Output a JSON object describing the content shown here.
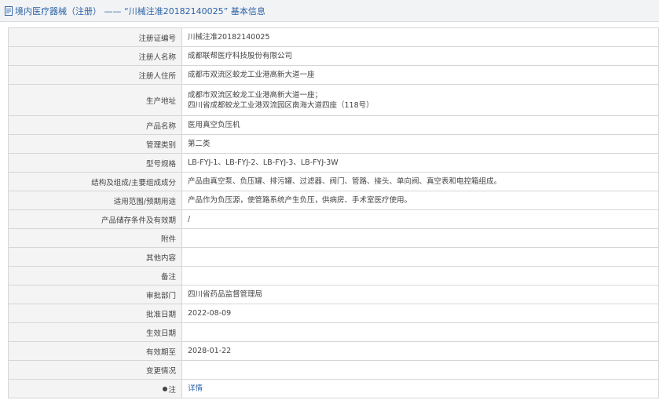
{
  "header": {
    "title": "境内医疗器械（注册） —— “川械注准20182140025” 基本信息"
  },
  "rows": [
    {
      "key": "注册证编号",
      "value": "川械注准20182140025"
    },
    {
      "key": "注册人名称",
      "value": "成都联帮医疗科技股份有限公司"
    },
    {
      "key": "注册人住所",
      "value": "成都市双流区蛟龙工业港高新大道一座"
    },
    {
      "key": "生产地址",
      "value": "成都市双流区蛟龙工业港高新大道一座；",
      "value2": "四川省成都蛟龙工业港双流园区南海大道四座（118号）"
    },
    {
      "key": "产品名称",
      "value": "医用真空负压机"
    },
    {
      "key": "管理类别",
      "value": "第二类"
    },
    {
      "key": "型号规格",
      "value": "LB-FYJ-1、LB-FYJ-2、LB-FYJ-3、LB-FYJ-3W"
    },
    {
      "key": "结构及组成/主要组成成分",
      "value": "产品由真空泵、负压罐、排污罐、过滤器、阀门、管路、接头、单向阀、真空表和电控箱组成。"
    },
    {
      "key": "适用范围/预期用途",
      "value": "产品作为负压源，使管路系统产生负压，供病房、手术室医疗使用。"
    },
    {
      "key": "产品储存条件及有效期",
      "value": "/"
    },
    {
      "key": "附件",
      "value": ""
    },
    {
      "key": "其他内容",
      "value": ""
    },
    {
      "key": "备注",
      "value": ""
    },
    {
      "key": "审批部门",
      "value": "四川省药品监督管理局"
    },
    {
      "key": "批准日期",
      "value": "2022-08-09"
    },
    {
      "key": "生效日期",
      "value": ""
    },
    {
      "key": "有效期至",
      "value": "2028-01-22"
    },
    {
      "key": "变更情况",
      "value": ""
    },
    {
      "key": "注",
      "value": "详情"
    }
  ]
}
